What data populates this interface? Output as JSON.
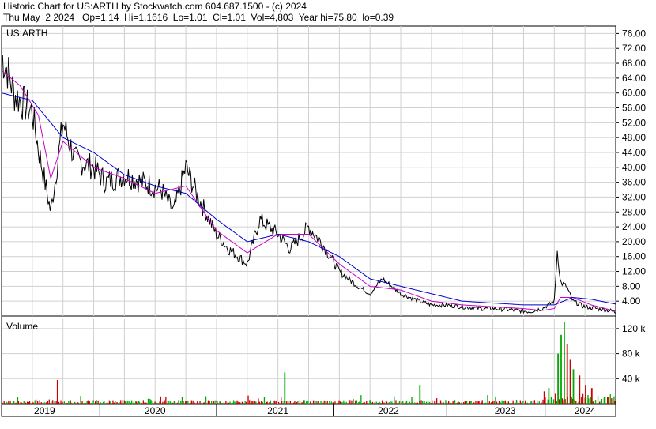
{
  "header": {
    "line1": "Historic Chart for US:ARTH by Stockwatch.com 604.687.1500 - (c) 2024",
    "line2": "Thu May  2 2024   Op=1.14  Hi=1.1616  Lo=1.01  Cl=1.01  Vol=4,803  Year hi=75.80  lo=0.39"
  },
  "chart_data": [
    {
      "type": "line",
      "title": "US:ARTH",
      "y_ticks": [
        "76.00",
        "72.00",
        "68.00",
        "64.00",
        "60.00",
        "56.00",
        "52.00",
        "48.00",
        "44.00",
        "40.00",
        "36.00",
        "32.00",
        "28.00",
        "24.00",
        "20.00",
        "16.00",
        "12.00",
        "8.00",
        "4.00"
      ],
      "ylim": [
        0,
        78
      ],
      "grid": true,
      "colors": {
        "price": "#000000",
        "ma_short": "#cc00cc",
        "ma_long": "#0000cc",
        "grid": "#d0d0d0"
      },
      "series": [
        {
          "key": "price",
          "t": [
            0,
            0.01,
            0.02,
            0.03,
            0.05,
            0.06,
            0.08,
            0.1,
            0.12,
            0.15,
            0.17,
            0.2,
            0.23,
            0.26,
            0.28,
            0.3,
            0.32,
            0.35,
            0.37,
            0.4,
            0.42,
            0.45,
            0.47,
            0.5,
            0.52,
            0.55,
            0.58,
            0.6,
            0.62,
            0.65,
            0.68,
            0.7,
            0.72,
            0.75,
            0.78,
            0.8,
            0.82,
            0.84,
            0.86,
            0.88,
            0.9,
            0.905,
            0.91,
            0.92,
            0.93,
            0.95,
            0.97,
            0.99,
            1.0
          ],
          "v": [
            70,
            66,
            60,
            58,
            55,
            45,
            28,
            52,
            42,
            40,
            36,
            38,
            36,
            34,
            28,
            40,
            32,
            22,
            18,
            14,
            26,
            22,
            18,
            24,
            20,
            12,
            8,
            6,
            10,
            6,
            4,
            3,
            3,
            2.5,
            2,
            2,
            1.8,
            1.5,
            1.2,
            2,
            4,
            18,
            9,
            8,
            4,
            2.5,
            2,
            1.5,
            1.0
          ]
        },
        {
          "key": "ma_short",
          "t": [
            0,
            0.03,
            0.06,
            0.08,
            0.1,
            0.15,
            0.2,
            0.25,
            0.3,
            0.35,
            0.4,
            0.45,
            0.5,
            0.55,
            0.6,
            0.65,
            0.7,
            0.75,
            0.8,
            0.85,
            0.88,
            0.9,
            0.91,
            0.93,
            0.96,
            1.0
          ],
          "v": [
            66,
            62,
            54,
            37,
            47,
            40,
            37,
            33,
            35,
            23,
            17,
            22,
            22,
            14,
            8,
            7,
            4,
            3,
            2.5,
            2,
            1.5,
            2,
            5,
            5,
            3,
            1.3
          ]
        },
        {
          "key": "ma_long",
          "t": [
            0,
            0.05,
            0.1,
            0.15,
            0.2,
            0.25,
            0.3,
            0.35,
            0.4,
            0.45,
            0.5,
            0.55,
            0.6,
            0.65,
            0.7,
            0.75,
            0.8,
            0.85,
            0.88,
            0.9,
            0.93,
            0.96,
            1.0
          ],
          "v": [
            60,
            58,
            48,
            44,
            38,
            35,
            33,
            26,
            20,
            22,
            20,
            16,
            10,
            8,
            6,
            4,
            3.5,
            3,
            3,
            3,
            5,
            4.5,
            3.2
          ]
        }
      ]
    },
    {
      "type": "bar",
      "title": "Volume",
      "y_ticks": [
        "120 k",
        "80 k",
        "40 k"
      ],
      "ylim": [
        0,
        135
      ],
      "colors": {
        "up": "#00aa00",
        "down": "#cc0000"
      },
      "spikes": [
        {
          "t": 0.09,
          "value": 38,
          "dir": "down"
        },
        {
          "t": 0.46,
          "value": 50,
          "dir": "up"
        },
        {
          "t": 0.68,
          "value": 30,
          "dir": "up"
        },
        {
          "t": 0.89,
          "value": 25,
          "dir": "up"
        },
        {
          "t": 0.905,
          "value": 80,
          "dir": "up"
        },
        {
          "t": 0.91,
          "value": 110,
          "dir": "up"
        },
        {
          "t": 0.915,
          "value": 130,
          "dir": "up"
        },
        {
          "t": 0.92,
          "value": 95,
          "dir": "down"
        },
        {
          "t": 0.925,
          "value": 70,
          "dir": "down"
        },
        {
          "t": 0.93,
          "value": 55,
          "dir": "up"
        },
        {
          "t": 0.94,
          "value": 45,
          "dir": "down"
        },
        {
          "t": 0.95,
          "value": 30,
          "dir": "down"
        },
        {
          "t": 0.96,
          "value": 25,
          "dir": "down"
        }
      ]
    }
  ],
  "x_axis": {
    "labels": [
      "2019",
      "2020",
      "2021",
      "2022",
      "2023",
      "2024"
    ],
    "positions": [
      0.07,
      0.25,
      0.45,
      0.63,
      0.82,
      0.95
    ]
  }
}
